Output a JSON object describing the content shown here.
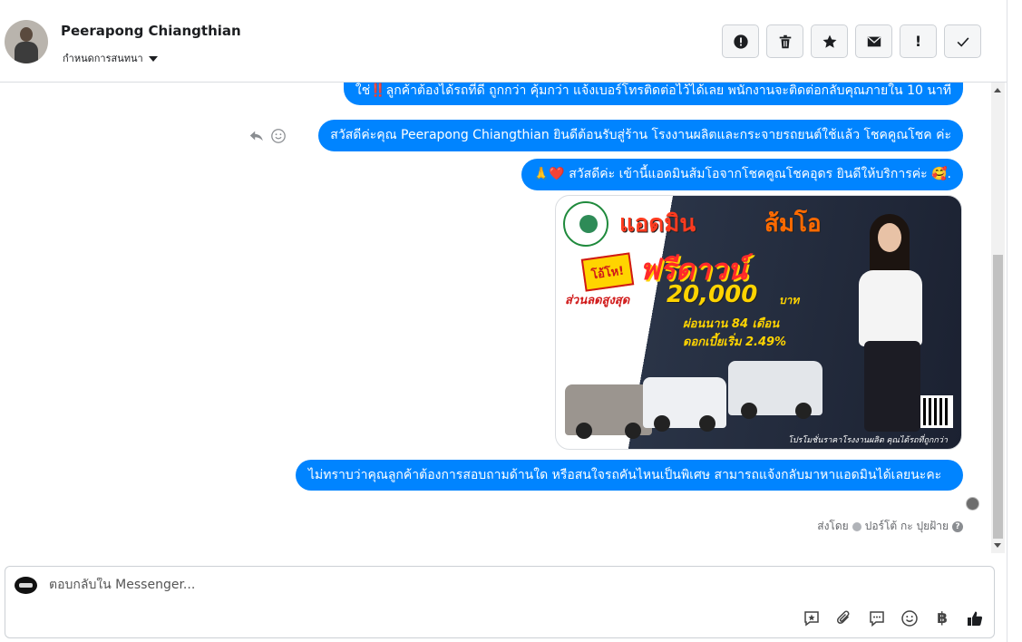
{
  "header": {
    "contact_name": "Peerapong Chiangthian",
    "label_dropdown": "กำหนดการสนทนา",
    "actions": [
      {
        "name": "spam-report",
        "icon": "alert-circle-icon"
      },
      {
        "name": "delete",
        "icon": "trash-icon"
      },
      {
        "name": "star",
        "icon": "star-icon"
      },
      {
        "name": "mark-unread",
        "icon": "envelope-icon"
      },
      {
        "name": "important",
        "icon": "exclamation-icon",
        "label": "!"
      },
      {
        "name": "mark-done",
        "icon": "checkmark-icon"
      }
    ]
  },
  "thread": {
    "messages": [
      {
        "text": "ใช่‼️ลูกค้าต้องได้รถที่ดี ถูกกว่า คุ้มกว่า แจ้งเบอร์โทรติดต่อไว้ได้เลย พนักงานจะติดต่อกลับคุณภายใน 10 นาที"
      },
      {
        "text": "สวัสดีค่ะคุณ Peerapong Chiangthian ยินดีต้อนรับสู่ร้าน โรงงานผลิตและกระจายรถยนต์ใช้แล้ว โชคคูณโชค ค่ะ"
      },
      {
        "text": "🙏❤️ สวัสดีค่ะ เข้านี้แอดมินส้มโอจากโชคคูณโชคอุดร ยินดีให้บริการค่ะ 🥰."
      },
      {
        "text": "ไม่ทราบว่าคุณลูกค้าต้องการสอบถามด้านใด หรือสนใจรถคันไหนเป็นพิเศษ สามารถแจ้งกลับมาหาแอดมินได้เลยนะคะ"
      }
    ],
    "promo_image": {
      "title_left": "แอดมิน",
      "title_right": "ส้มโอ",
      "badge": "โอ้โห!",
      "headline": "ฟรีดาวน์",
      "discount_label": "ส่วนลดสูงสุด",
      "discount_amount": "20,000",
      "currency": "บาท",
      "installment": "ผ่อนนาน 84 เดือน",
      "rate": "ดอกเบี้ยเริ่ม 2.49%",
      "footer": "โปรโมชั่นราคาโรงงานผลิต คุณได้รถที่ถูกกว่า"
    },
    "sent_by": {
      "prefix": "ส่งโดย",
      "name": "ปอร์โต้ กะ ปุยฝ้าย"
    }
  },
  "composer": {
    "placeholder": "ตอบกลับใน Messenger...",
    "tools": [
      "saved-reply-icon",
      "attachment-icon",
      "quick-reply-icon",
      "emoji-icon",
      "baht-icon",
      "thumbs-up-icon"
    ],
    "baht_symbol": "฿"
  },
  "colors": {
    "bubble": "#0084ff",
    "like": "#1c1e21"
  }
}
